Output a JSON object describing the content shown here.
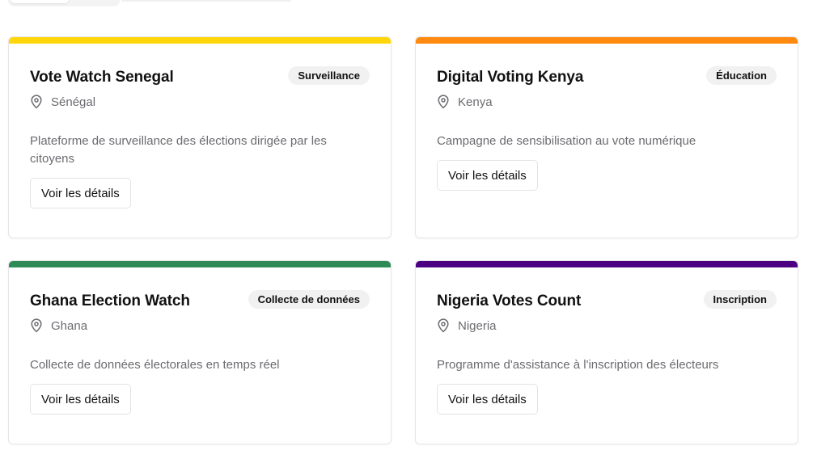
{
  "cards": [
    {
      "title": "Vote Watch Senegal",
      "badge": "Surveillance",
      "location": "Sénégal",
      "description": "Plateforme de surveillance des élections dirigée par les citoyens",
      "button_label": "Voir les détails",
      "accent_color": "#ffd60a"
    },
    {
      "title": "Digital Voting Kenya",
      "badge": "Éducation",
      "location": "Kenya",
      "description": "Campagne de sensibilisation au vote numérique",
      "button_label": "Voir les détails",
      "accent_color": "#ff8a0f"
    },
    {
      "title": "Ghana Election Watch",
      "badge": "Collecte de données",
      "location": "Ghana",
      "description": "Collecte de données électorales en temps réel",
      "button_label": "Voir les détails",
      "accent_color": "#2e8b57"
    },
    {
      "title": "Nigeria Votes Count",
      "badge": "Inscription",
      "location": "Nigeria",
      "description": "Programme d'assistance à l'inscription des électeurs",
      "button_label": "Voir les détails",
      "accent_color": "#4b0082"
    }
  ],
  "icons": {
    "location": "map-pin-icon"
  }
}
